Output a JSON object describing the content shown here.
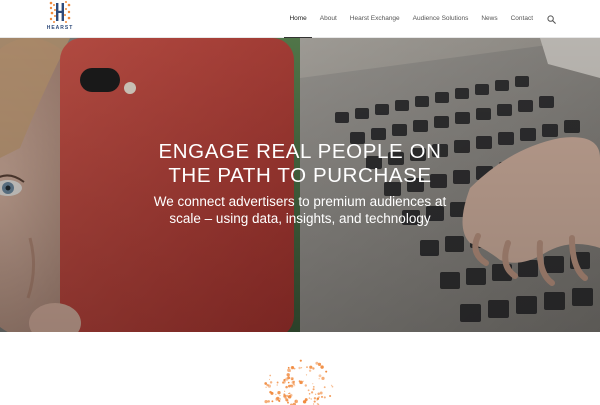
{
  "logo": {
    "text": "HEARST",
    "letter": "H"
  },
  "nav": {
    "items": [
      {
        "label": "Home",
        "active": true
      },
      {
        "label": "About",
        "active": false
      },
      {
        "label": "Hearst Exchange",
        "active": false
      },
      {
        "label": "Audience Solutions",
        "active": false
      },
      {
        "label": "News",
        "active": false
      },
      {
        "label": "Contact",
        "active": false
      }
    ],
    "search_icon": "search-icon"
  },
  "hero": {
    "title_line1": "ENGAGE REAL PEOPLE ON",
    "title_line2": "THE PATH TO PURCHASE",
    "subtitle_line1": "We connect advertisers to premium audiences at",
    "subtitle_line2": "scale – using data, insights, and technology"
  },
  "colors": {
    "accent_orange": "#f0883a",
    "brand_navy": "#2e4a7a",
    "phone_red": "#c9483f"
  }
}
